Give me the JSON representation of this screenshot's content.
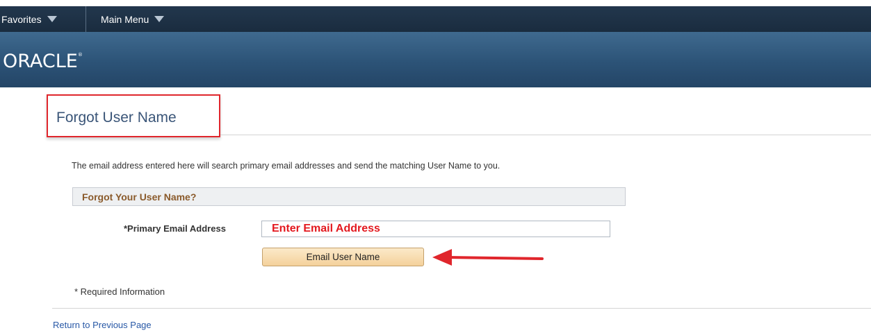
{
  "nav": {
    "favorites_label": "Favorites",
    "main_menu_label": "Main Menu"
  },
  "brand": {
    "logo_text": "ORACLE",
    "logo_mark": "®"
  },
  "page": {
    "title": "Forgot User Name",
    "description": "The email address entered here will search primary email addresses and send the matching User Name to you."
  },
  "form": {
    "group_title": "Forgot Your User Name?",
    "email_label": "*Primary Email Address",
    "email_value": "Enter Email Address",
    "submit_label": "Email User Name",
    "required_note": "* Required Information"
  },
  "footer": {
    "return_link": "Return to Previous Page"
  },
  "colors": {
    "nav_bar": "#1d3044",
    "brand_bar": "#2c5377",
    "title_text": "#3a5578",
    "highlight_red": "#e0262c",
    "group_title": "#8a5a2b",
    "link": "#2858a6",
    "button": "#f7ddb0"
  },
  "icons": {
    "favorites_caret": "chevron-down-icon",
    "main_menu_caret": "chevron-down-icon",
    "annotation": "red-arrow-left-icon"
  }
}
